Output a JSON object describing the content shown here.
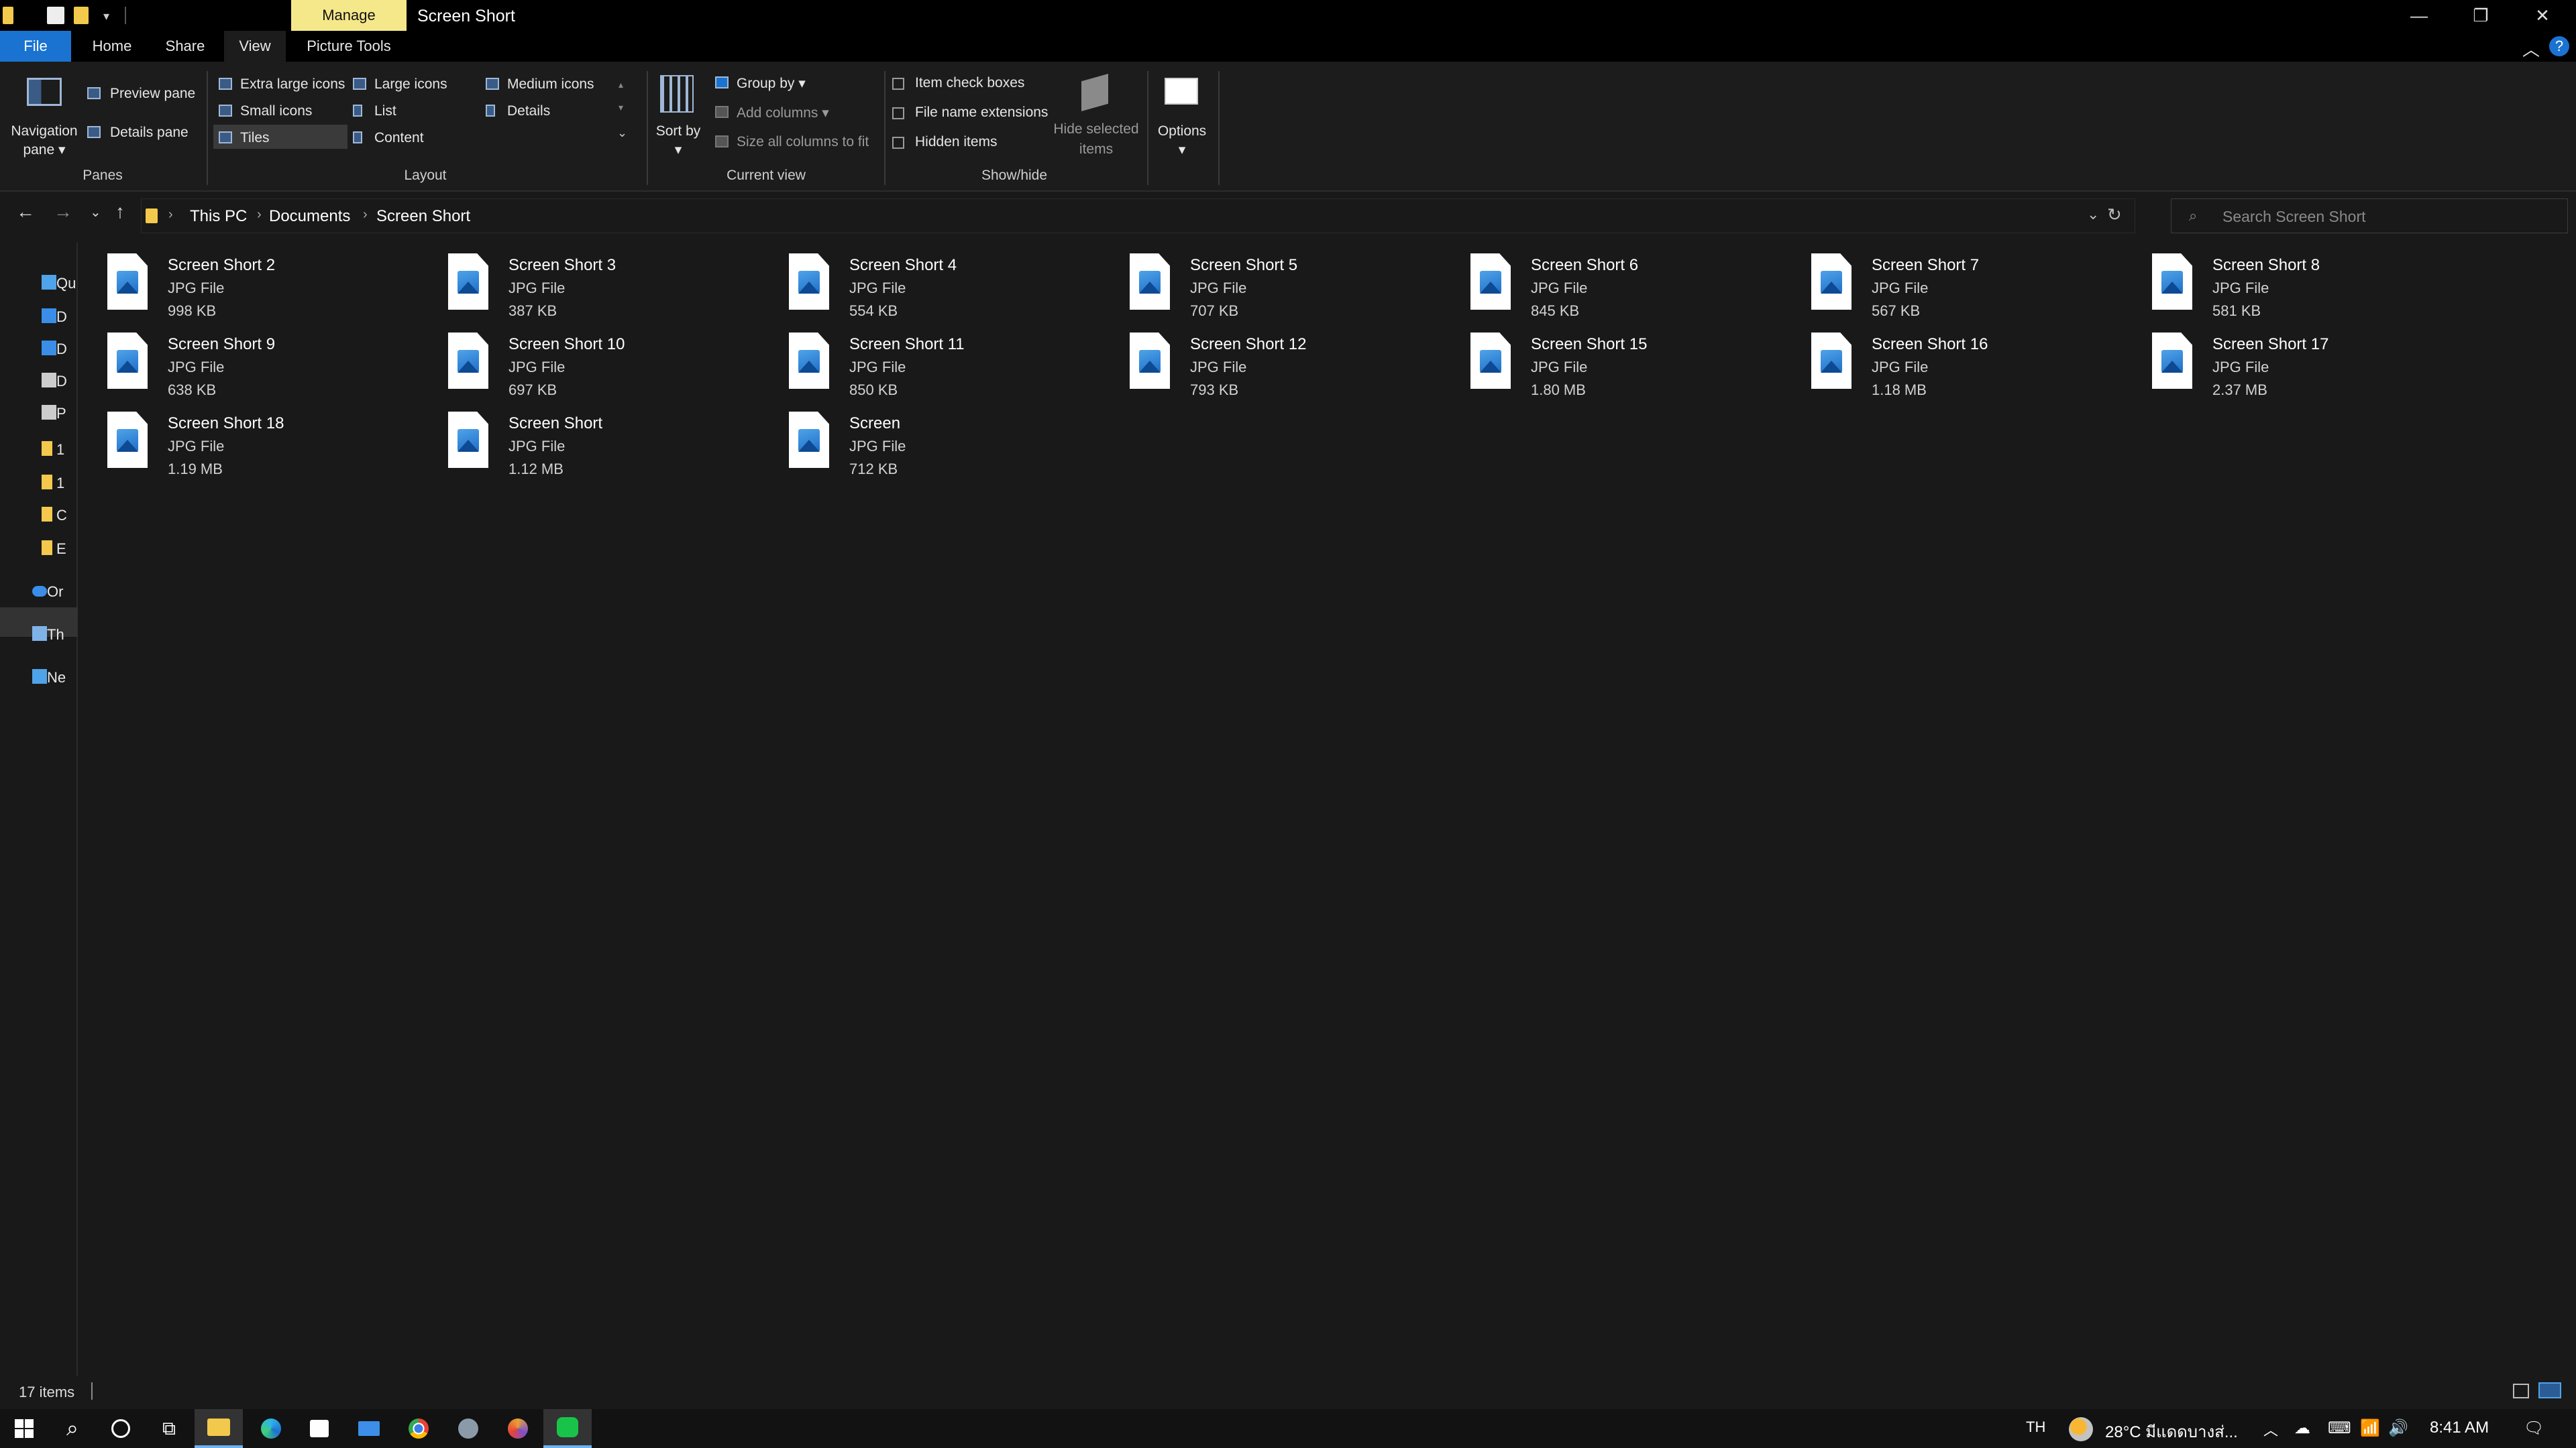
{
  "window": {
    "title": "Screen Short",
    "contextual_tab": "Manage",
    "controls": {
      "minimize": "—",
      "restore": "❐",
      "close": "✕"
    }
  },
  "ribbon_tabs": [
    "File",
    "Home",
    "Share",
    "View",
    "Picture Tools"
  ],
  "ribbon": {
    "panes": {
      "navigation_pane": "Navigation pane",
      "preview_pane": "Preview pane",
      "details_pane": "Details pane",
      "group_label": "Panes"
    },
    "layout": {
      "items": [
        "Extra large icons",
        "Large icons",
        "Medium icons",
        "Small icons",
        "List",
        "Details",
        "Tiles",
        "Content"
      ],
      "selected": "Tiles",
      "group_label": "Layout"
    },
    "current_view": {
      "sort_by": "Sort by",
      "group_by": "Group by",
      "add_columns": "Add columns",
      "size_all_columns": "Size all columns to fit",
      "group_label": "Current view"
    },
    "show_hide": {
      "item_check_boxes": "Item check boxes",
      "file_name_extensions": "File name extensions",
      "hidden_items": "Hidden items",
      "hide_selected_items": "Hide selected items",
      "group_label": "Show/hide"
    },
    "options": "Options"
  },
  "address": {
    "breadcrumb": [
      "This PC",
      "Documents",
      "Screen Short"
    ],
    "search_placeholder": "Search Screen Short"
  },
  "sidebar": {
    "items": [
      {
        "label": "Qu",
        "icon": "star-icon"
      },
      {
        "label": "D",
        "icon": "desktop-icon"
      },
      {
        "label": "D",
        "icon": "download-icon"
      },
      {
        "label": "D",
        "icon": "document-icon"
      },
      {
        "label": "P",
        "icon": "pictures-icon"
      },
      {
        "label": "1",
        "icon": "folder-icon"
      },
      {
        "label": "1",
        "icon": "folder-icon"
      },
      {
        "label": "C",
        "icon": "folder-icon"
      },
      {
        "label": "E",
        "icon": "folder-icon"
      },
      {
        "label": "Or",
        "icon": "onedrive-icon"
      },
      {
        "label": "Th",
        "icon": "this-pc-icon"
      },
      {
        "label": "Ne",
        "icon": "network-icon"
      }
    ]
  },
  "files": [
    {
      "name": "Screen Short 2",
      "type": "JPG File",
      "size": "998 KB"
    },
    {
      "name": "Screen Short 3",
      "type": "JPG File",
      "size": "387 KB"
    },
    {
      "name": "Screen Short 4",
      "type": "JPG File",
      "size": "554 KB"
    },
    {
      "name": "Screen Short 5",
      "type": "JPG File",
      "size": "707 KB"
    },
    {
      "name": "Screen Short 6",
      "type": "JPG File",
      "size": "845 KB"
    },
    {
      "name": "Screen Short 7",
      "type": "JPG File",
      "size": "567 KB"
    },
    {
      "name": "Screen Short 8",
      "type": "JPG File",
      "size": "581 KB"
    },
    {
      "name": "Screen Short 9",
      "type": "JPG File",
      "size": "638 KB"
    },
    {
      "name": "Screen Short 10",
      "type": "JPG File",
      "size": "697 KB"
    },
    {
      "name": "Screen Short 11",
      "type": "JPG File",
      "size": "850 KB"
    },
    {
      "name": "Screen Short 12",
      "type": "JPG File",
      "size": "793 KB"
    },
    {
      "name": "Screen Short 15",
      "type": "JPG File",
      "size": "1.80 MB"
    },
    {
      "name": "Screen Short 16",
      "type": "JPG File",
      "size": "1.18 MB"
    },
    {
      "name": "Screen Short 17",
      "type": "JPG File",
      "size": "2.37 MB"
    },
    {
      "name": "Screen Short 18",
      "type": "JPG File",
      "size": "1.19 MB"
    },
    {
      "name": "Screen Short",
      "type": "JPG File",
      "size": "1.12 MB"
    },
    {
      "name": "Screen",
      "type": "JPG File",
      "size": "712 KB"
    }
  ],
  "status": {
    "item_count": "17 items"
  },
  "taskbar": {
    "apps": [
      "start-icon",
      "search-icon",
      "cortana-icon",
      "task-view-icon",
      "file-explorer-icon",
      "edge-icon",
      "store-icon",
      "mail-icon",
      "chrome-icon",
      "app-icon",
      "chrome-alt-icon",
      "line-icon"
    ],
    "language": "TH",
    "weather": "28°C มีแดดบางส่...",
    "time": "8:41 AM"
  },
  "colors": {
    "accent": "#1a73d1",
    "manage_tab": "#f5e88a",
    "background": "#191919",
    "ribbon": "#1c1c1c"
  }
}
